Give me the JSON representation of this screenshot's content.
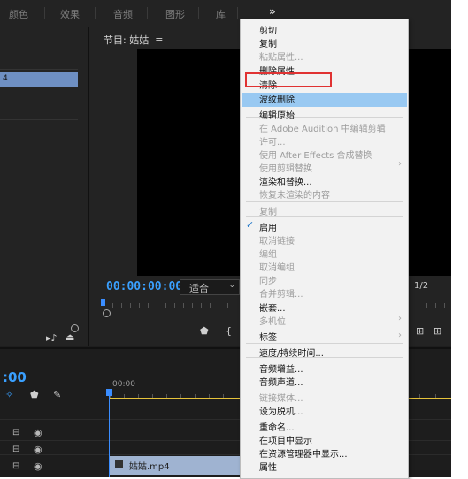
{
  "workspaces": [
    "颜色",
    "效果",
    "音频",
    "图形",
    "库"
  ],
  "more_symbol": "»",
  "program_monitor": {
    "title": "节目: 姑姑",
    "menu_icon": "≡",
    "timecode": "00:00:00:00",
    "fit_value": "适合",
    "fit_arrow": "⌄",
    "ratio": "1/2"
  },
  "left_panel": {
    "clip_label": "4"
  },
  "timeline": {
    "timecode": ":00",
    "ruler_time": ":00:00",
    "clip_name": "姑姑.mp4"
  },
  "context_menu": {
    "items": [
      {
        "label": "剪切",
        "enabled": true
      },
      {
        "label": "复制",
        "enabled": true
      },
      {
        "label": "粘贴属性...",
        "enabled": false
      },
      {
        "label": "删除属性...",
        "enabled": true
      },
      {
        "label": "清除",
        "enabled": true,
        "highlighted": true
      },
      {
        "label": "波纹删除",
        "enabled": true
      },
      {
        "label": "编辑原始",
        "enabled": true
      },
      {
        "label": "在 Adobe Audition 中编辑剪辑",
        "enabled": false
      },
      {
        "label": "许可...",
        "enabled": false
      },
      {
        "label": "使用 After Effects 合成替换",
        "enabled": false
      },
      {
        "label": "使用剪辑替换",
        "enabled": false,
        "submenu": true
      },
      {
        "label": "渲染和替换...",
        "enabled": true
      },
      {
        "label": "恢复未渲染的内容",
        "enabled": false
      },
      {
        "label": "复制",
        "enabled": false
      },
      {
        "label": "启用",
        "enabled": true,
        "checked": true
      },
      {
        "label": "取消链接",
        "enabled": false
      },
      {
        "label": "编组",
        "enabled": false
      },
      {
        "label": "取消编组",
        "enabled": false
      },
      {
        "label": "同步",
        "enabled": false
      },
      {
        "label": "合并剪辑...",
        "enabled": false
      },
      {
        "label": "嵌套...",
        "enabled": true
      },
      {
        "label": "多机位",
        "enabled": false,
        "submenu": true
      },
      {
        "label": "标签",
        "enabled": true,
        "submenu": true
      },
      {
        "label": "速度/持续时间...",
        "enabled": true
      },
      {
        "label": "音频增益...",
        "enabled": true
      },
      {
        "label": "音频声道...",
        "enabled": true
      },
      {
        "label": "链接媒体...",
        "enabled": false
      },
      {
        "label": "设为脱机...",
        "enabled": true
      },
      {
        "label": "重命名...",
        "enabled": true
      },
      {
        "label": "在项目中显示",
        "enabled": true
      },
      {
        "label": "在资源管理器中显示...",
        "enabled": true
      },
      {
        "label": "属性",
        "enabled": true
      }
    ],
    "submenu_arrow": "›",
    "check_mark": "✓"
  },
  "colors": {
    "highlight": "#99c9f2",
    "accent_blue": "#3aa0ff",
    "red_box": "#e03232",
    "clip_blue": "#6e8fc2"
  }
}
